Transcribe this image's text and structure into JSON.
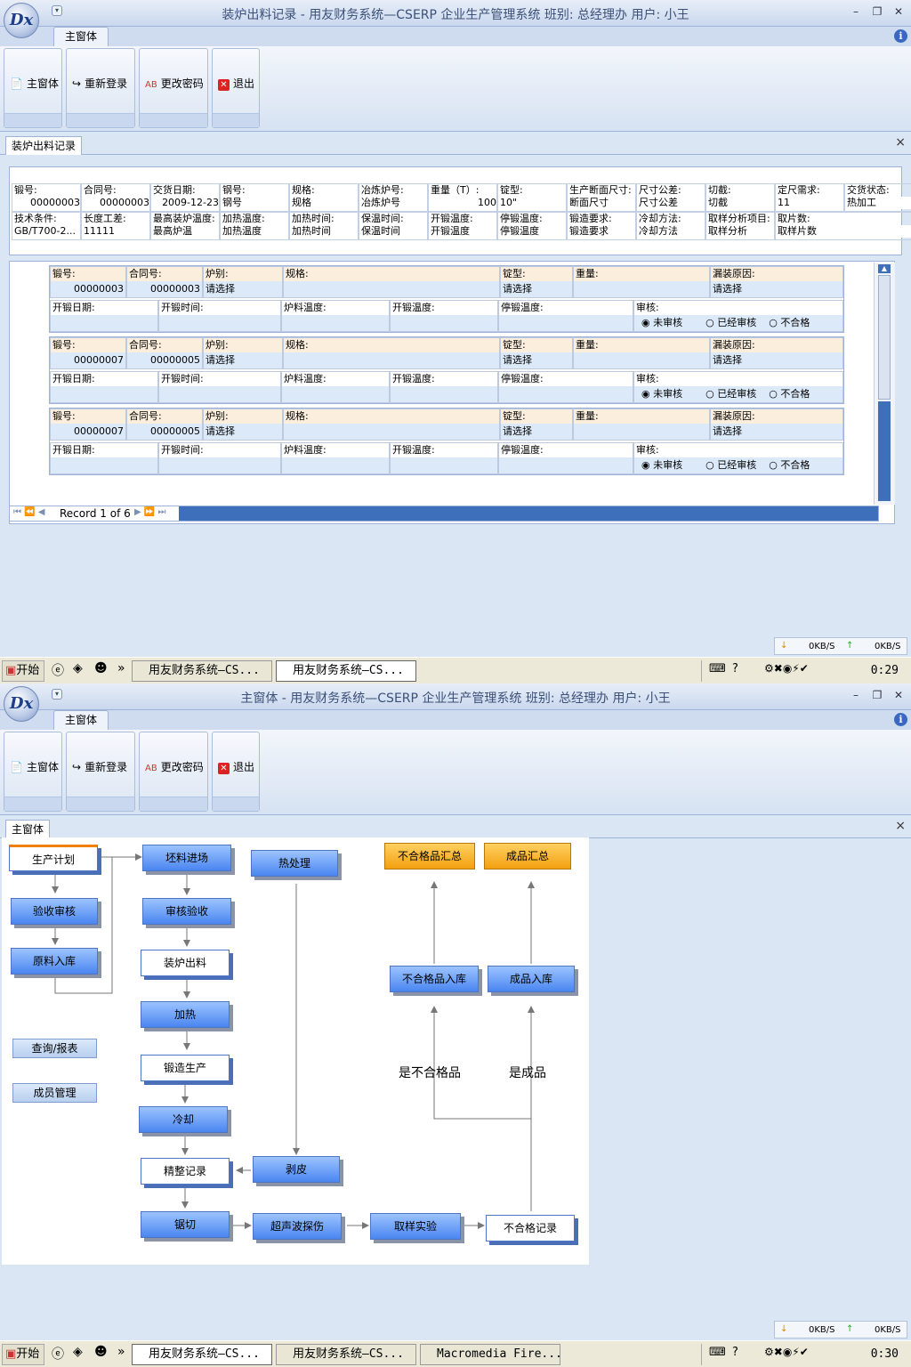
{
  "common": {
    "logo": "Dx",
    "ribbon_tab": "主窗体",
    "ribbon_buttons": [
      "主窗体",
      "重新登录",
      "更改密码",
      "退出"
    ],
    "status_down": "0KB/S",
    "status_up": "0KB/S",
    "start": "开始",
    "task1": "用友财务系统—CS...",
    "task2": "用友财务系统—CS...",
    "task3": "Macromedia Fire..."
  },
  "screen1": {
    "title": "装炉出料记录 - 用友财务系统—CSERP 企业生产管理系统 班别: 总经理办 用户: 小王",
    "doc_tab": "装炉出料记录",
    "form_row1": [
      {
        "label": "锻号:",
        "value": "00000003"
      },
      {
        "label": "合同号:",
        "value": "00000003"
      },
      {
        "label": "交货日期:",
        "value": "2009-12-23"
      },
      {
        "label": "钢号:",
        "value": "钢号"
      },
      {
        "label": "规格:",
        "value": "规格"
      },
      {
        "label": "冶炼炉号:",
        "value": "冶炼炉号"
      },
      {
        "label": "重量（T）:",
        "value": "100"
      },
      {
        "label": "锭型:",
        "value": "10\""
      },
      {
        "label": "生产断面尺寸:",
        "value": "断面尺寸"
      },
      {
        "label": "尺寸公差:",
        "value": "尺寸公差"
      },
      {
        "label": "切截:",
        "value": "切截"
      },
      {
        "label": "定尺需求:",
        "value": "11"
      },
      {
        "label": "交货状态:",
        "value": "热加工"
      }
    ],
    "form_row2": [
      {
        "label": "技术条件:",
        "value": "GB/T700-2..."
      },
      {
        "label": "长度工差:",
        "value": "11111"
      },
      {
        "label": "最高装炉温度:",
        "value": "最高炉温"
      },
      {
        "label": "加热温度:",
        "value": "加热温度"
      },
      {
        "label": "加热时间:",
        "value": "加热时间"
      },
      {
        "label": "保温时间:",
        "value": "保温时间"
      },
      {
        "label": "开锻温度:",
        "value": "开锻温度"
      },
      {
        "label": "停锻温度:",
        "value": "停锻温度"
      },
      {
        "label": "锻造要求:",
        "value": "锻造要求"
      },
      {
        "label": "冷却方法:",
        "value": "冷却方法"
      },
      {
        "label": "取样分析项目:",
        "value": "取样分析"
      },
      {
        "label": "取片数:",
        "value": "取样片数"
      }
    ],
    "records": [
      {
        "forge_no": "00000003",
        "contract": "00000003",
        "furnace": "请选择",
        "ingot": "请选择",
        "leak": "请选择"
      },
      {
        "forge_no": "00000007",
        "contract": "00000005",
        "furnace": "请选择",
        "ingot": "请选择",
        "leak": "请选择"
      },
      {
        "forge_no": "00000007",
        "contract": "00000005",
        "furnace": "请选择",
        "ingot": "请选择",
        "leak": "请选择"
      }
    ],
    "rec_labels": {
      "forge_no": "锻号:",
      "contract": "合同号:",
      "furnace": "炉别:",
      "spec": "规格:",
      "ingot": "锭型:",
      "weight": "重量:",
      "leak": "漏装原因:",
      "date": "开锻日期:",
      "time": "开锻时间:",
      "ftemp": "炉料温度:",
      "stemp": "开锻温度:",
      "etemp": "停锻温度:",
      "audit": "审核:",
      "opt1": "未审核",
      "opt2": "已经审核",
      "opt3": "不合格"
    },
    "record_nav": "Record 1 of 6",
    "clock": "0:29"
  },
  "screen2": {
    "title": "主窗体 - 用友财务系统—CSERP 企业生产管理系统 班别: 总经理办 用户: 小王",
    "doc_tab": "主窗体",
    "nodes": {
      "plan": "生产计划",
      "inspect": "验收审核",
      "raw": "原料入库",
      "query": "查询/报表",
      "member": "成员管理",
      "billet": "坯料进场",
      "review": "审核验收",
      "charge": "装炉出料",
      "heat": "加热",
      "forge": "锻造生产",
      "cool": "冷却",
      "finish": "精整记录",
      "saw": "锯切",
      "ultra": "超声波探伤",
      "sample": "取样实验",
      "reject": "不合格记录",
      "heattreat": "热处理",
      "peel": "剥皮",
      "bad_in": "不合格品入库",
      "good_in": "成品入库",
      "bad_sum": "不合格品汇总",
      "good_sum": "成品汇总"
    },
    "labels": {
      "is_bad": "是不合格品",
      "is_good": "是成品"
    },
    "clock": "0:30"
  }
}
